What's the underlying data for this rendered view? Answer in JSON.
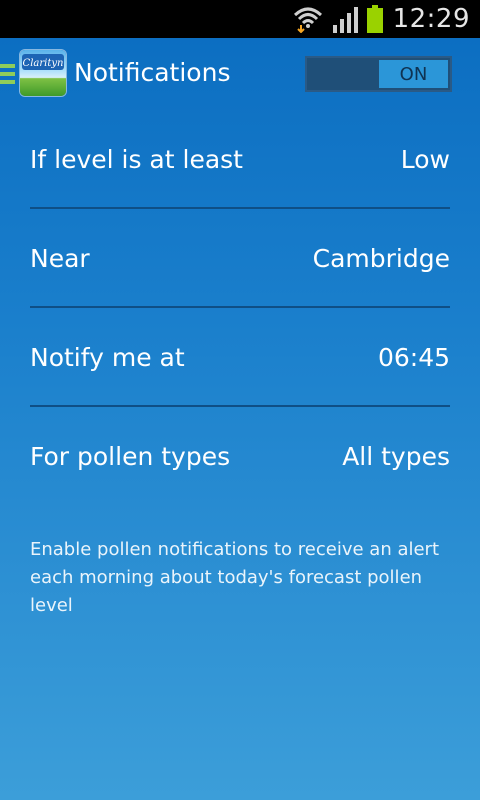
{
  "status_bar": {
    "time": "12:29",
    "wifi_icon": "wifi-icon",
    "signal_icon": "signal-icon",
    "battery_icon": "battery-icon",
    "battery_color": "#9ad200"
  },
  "action_bar": {
    "menu_icon": "drawer-menu-icon",
    "logo_text": "Clarityn",
    "title": "Notifications",
    "toggle_label": "ON"
  },
  "settings": [
    {
      "label": "If level is at least",
      "value": "Low"
    },
    {
      "label": "Near",
      "value": "Cambridge"
    },
    {
      "label": "Notify me at",
      "value": "06:45"
    },
    {
      "label": "For pollen types",
      "value": "All types"
    }
  ],
  "info_text": "Enable pollen notifications to receive an alert each morning about today's forecast pollen level",
  "colors": {
    "background_top": "#0a6cc0",
    "background_bottom": "#3c9ed9",
    "divider": "#0f4f86",
    "accent_green": "#8fcd5a",
    "toggle_on": "#2b96d8"
  }
}
